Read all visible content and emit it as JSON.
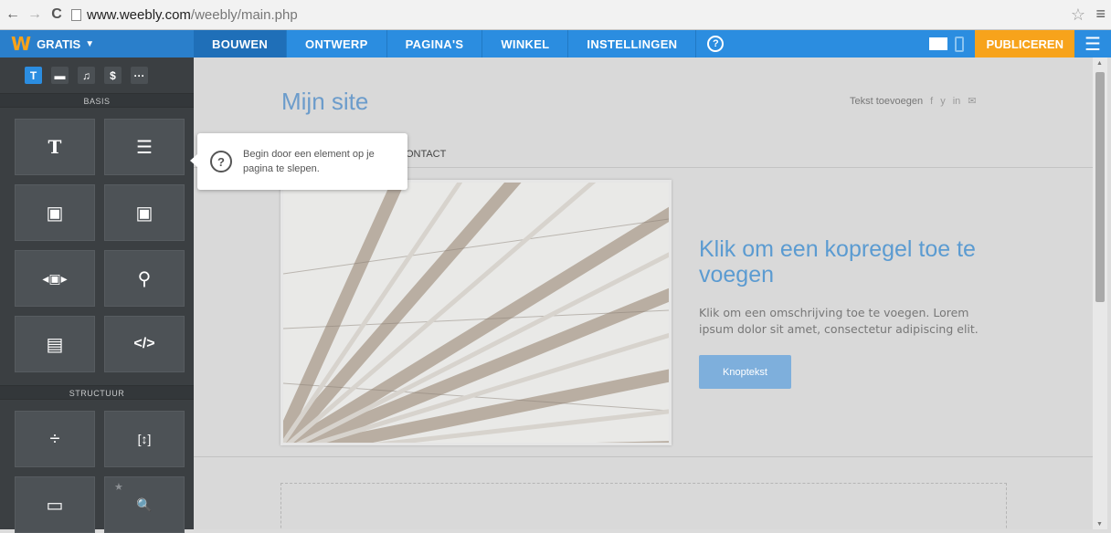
{
  "browser": {
    "back": "←",
    "forward": "→",
    "reload": "C",
    "url_host": "www.weebly.com",
    "url_path": "/weebly/main.php",
    "star": "☆",
    "menu": "≡"
  },
  "appbar": {
    "brand_logo": "W",
    "brand_label": "GRATIS",
    "tabs": [
      "BOUWEN",
      "ONTWERP",
      "PAGINA'S",
      "WINKEL",
      "INSTELLINGEN"
    ],
    "help": "?",
    "publish": "PUBLICEREN",
    "colors": {
      "bar": "#2b8de0",
      "publish": "#f7a31b",
      "logo": "#f8a21a"
    }
  },
  "sidebar": {
    "categories": [
      "T",
      "▬",
      "♫",
      "$",
      "···"
    ],
    "basic_label": "BASIS",
    "structure_label": "STRUCTUUR",
    "basic_tiles": [
      {
        "icon": "title-icon",
        "glyph": "T"
      },
      {
        "icon": "text-icon",
        "glyph": "☰"
      },
      {
        "icon": "image-icon",
        "glyph": "▣"
      },
      {
        "icon": "gallery-icon",
        "glyph": "▣"
      },
      {
        "icon": "slideshow-icon",
        "glyph": "◂▣▸"
      },
      {
        "icon": "map-icon",
        "glyph": "⚲"
      },
      {
        "icon": "form-icon",
        "glyph": "▤"
      },
      {
        "icon": "embed-code-icon",
        "glyph": "</>"
      }
    ],
    "structure_tiles": [
      {
        "icon": "divider-icon",
        "glyph": "÷"
      },
      {
        "icon": "spacer-icon",
        "glyph": "[↕]"
      },
      {
        "icon": "button-icon",
        "glyph": "▭"
      },
      {
        "icon": "search-icon",
        "glyph": "🔍"
      }
    ]
  },
  "canvas": {
    "site_title": "Mijn site",
    "header_text": "Tekst toevoegen",
    "social": [
      "f",
      "y",
      "in",
      "✉"
    ],
    "nav_item": "CONTACT",
    "headline": "Klik om een kopregel toe te voegen",
    "description": "Klik om een omschrijving toe te voegen. Lorem ipsum dolor sit amet, consectetur adipiscing elit.",
    "button": "Knoptekst"
  },
  "tooltip": {
    "icon": "?",
    "text": "Begin door een element op je pagina te slepen."
  }
}
